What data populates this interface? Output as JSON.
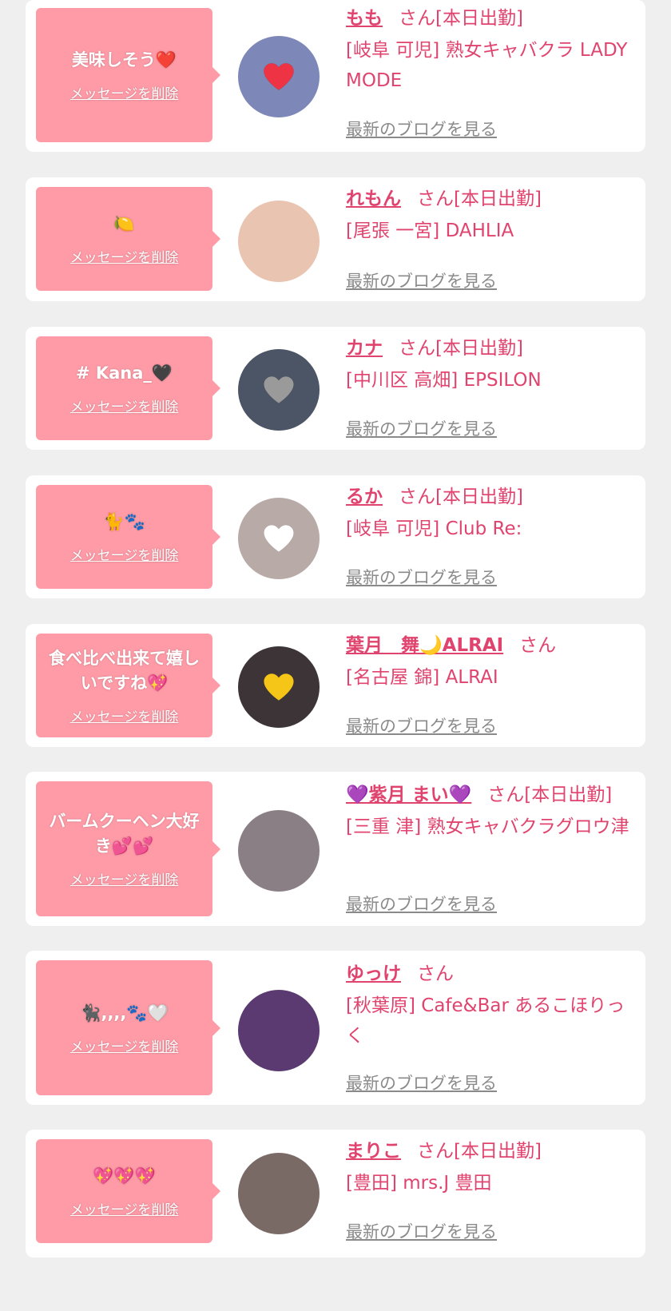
{
  "colors": {
    "background": "#efefef",
    "card": "#ffffff",
    "bubble": "#fe9ba7",
    "accent": "#e0446e",
    "link_gray": "#8a8a8a"
  },
  "cards": [
    {
      "message": "美味しそう❤️",
      "delete_label": "メッセージを削除",
      "name": "もも",
      "san": "さん[本日出勤]",
      "shop": "[岐阜 可児] 熟女キャバクラ LADY MODE",
      "blog_label": "最新のブログを見る",
      "avatar_bg": "#7d87b8",
      "avatar_mark": "red-heart-sticker"
    },
    {
      "message": "🍋",
      "delete_label": "メッセージを削除",
      "name": "れもん",
      "san": "さん[本日出勤]",
      "shop": "[尾張 一宮] DAHLIA",
      "blog_label": "最新のブログを見る",
      "avatar_bg": "#e9c4b0",
      "avatar_mark": ""
    },
    {
      "message": "# Kana_🖤",
      "delete_label": "メッセージを削除",
      "name": "カナ",
      "san": "さん[本日出勤]",
      "shop": "[中川区 高畑] EPSILON",
      "blog_label": "最新のブログを見る",
      "avatar_bg": "#4b5566",
      "avatar_mark": "gray-heart-sticker"
    },
    {
      "message": "🐈🐾",
      "delete_label": "メッセージを削除",
      "name": "るか",
      "san": "さん[本日出勤]",
      "shop": "[岐阜 可児] Club Re:",
      "blog_label": "最新のブログを見る",
      "avatar_bg": "#b8aaa6",
      "avatar_mark": "white-heart-sticker"
    },
    {
      "message": "食べ比べ出来て嬉しいですね💖",
      "delete_label": "メッセージを削除",
      "name": "葉月　舞🌙ALRAI",
      "san": "さん",
      "shop": "[名古屋 錦] ALRAI",
      "blog_label": "最新のブログを見る",
      "avatar_bg": "#3d3438",
      "avatar_mark": "yellow-heart-sticker"
    },
    {
      "message": "バームクーヘン大好き💕💕",
      "delete_label": "メッセージを削除",
      "name": "💜紫月 まい💜",
      "san": "さん[本日出勤]",
      "shop": "[三重 津] 熟女キャバクラグロウ津",
      "blog_label": "最新のブログを見る",
      "avatar_bg": "#8b7f86",
      "avatar_mark": ""
    },
    {
      "message": "🐈‍⬛,,,,🐾🤍",
      "delete_label": "メッセージを削除",
      "name": "ゆっけ",
      "san": "さん",
      "shop": "[秋葉原] Cafe&Bar あるこほりっく",
      "blog_label": "最新のブログを見る",
      "avatar_bg": "#5a3a70",
      "avatar_mark": ""
    },
    {
      "message": "💖💖💖",
      "delete_label": "メッセージを削除",
      "name": "まりこ",
      "san": "さん[本日出勤]",
      "shop": "[豊田] mrs.J 豊田",
      "blog_label": "最新のブログを見る",
      "avatar_bg": "#7a6a66",
      "avatar_mark": ""
    }
  ]
}
